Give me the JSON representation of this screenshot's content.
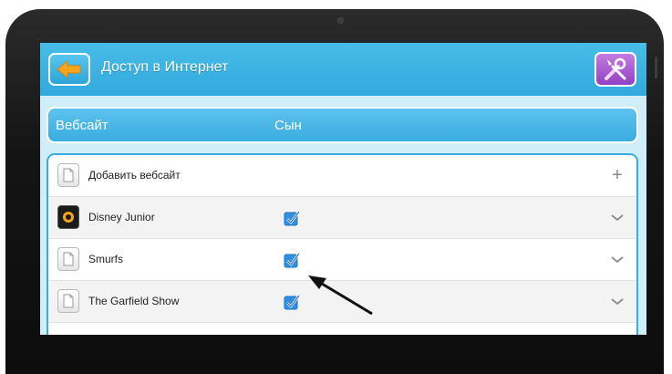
{
  "app": {
    "title": "Доступ в Интернет"
  },
  "toolbar": {
    "back_icon": "arrow-left-icon",
    "settings_icon": "tools-icon"
  },
  "table": {
    "columns": [
      "Вебсайт",
      "Сын"
    ]
  },
  "rows": [
    {
      "label": "Добавить вебсайт",
      "icon": "page-icon",
      "checked": null,
      "action": "+"
    },
    {
      "label": "Disney Junior",
      "icon": "disney-junior-logo",
      "checked": true,
      "action": "chevron-down-icon"
    },
    {
      "label": "Smurfs",
      "icon": "page-icon",
      "checked": true,
      "action": "chevron-down-icon"
    },
    {
      "label": "The Garfield Show",
      "icon": "page-icon",
      "checked": true,
      "action": "chevron-down-icon"
    }
  ],
  "colors": {
    "topbar": "#31a9dd",
    "accent_orange": "#f7a51e",
    "settings_purple": "#9142c2",
    "check_blue": "#1e74c9"
  }
}
